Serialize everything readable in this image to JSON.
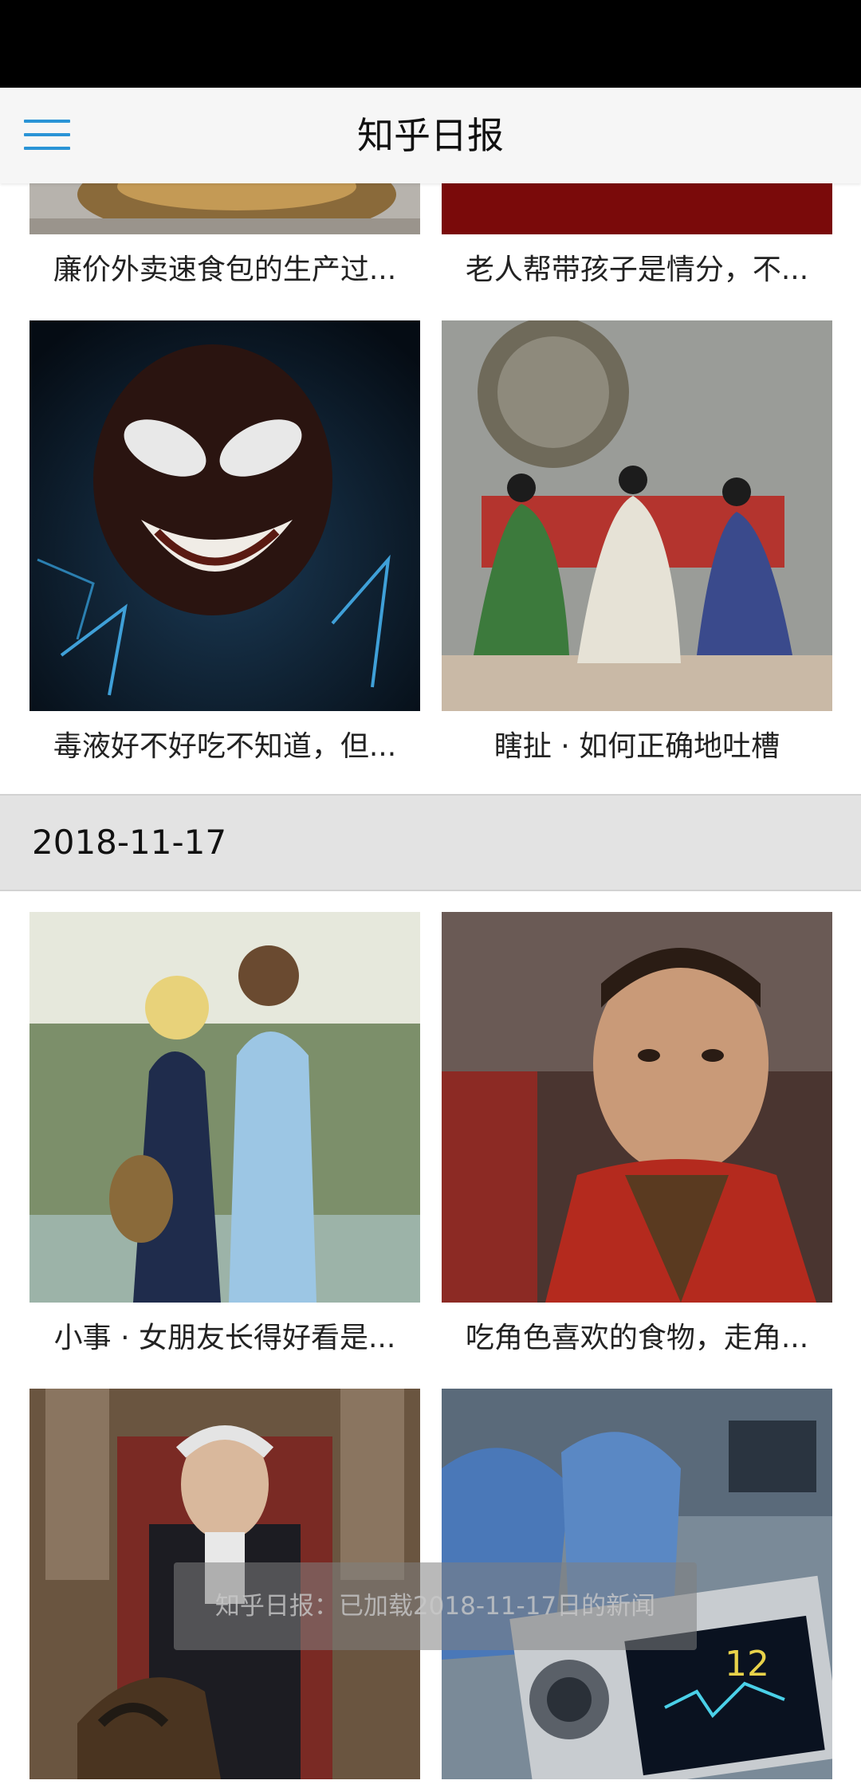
{
  "app_bar": {
    "title": "知乎日报"
  },
  "sections": [
    {
      "cards": [
        {
          "title": "廉价外卖速食包的生产过..."
        },
        {
          "title": "老人帮带孩子是情分，不..."
        },
        {
          "title": "毒液好不好吃不知道，但..."
        },
        {
          "title": "瞎扯 · 如何正确地吐槽"
        }
      ]
    },
    {
      "date": "2018-11-17",
      "cards": [
        {
          "title": "小事 · 女朋友长得好看是..."
        },
        {
          "title": "吃角色喜欢的食物，走角..."
        },
        {
          "title": ""
        },
        {
          "title": ""
        }
      ]
    }
  ],
  "toast": {
    "text": "知乎日报：已加载2018-11-17日的新闻"
  },
  "colors": {
    "accent": "#2a94d6",
    "status_bar": "#000000",
    "app_bar_bg": "#f6f6f6",
    "date_header_bg": "#e3e3e3"
  },
  "icons": {
    "menu": "menu-icon"
  }
}
